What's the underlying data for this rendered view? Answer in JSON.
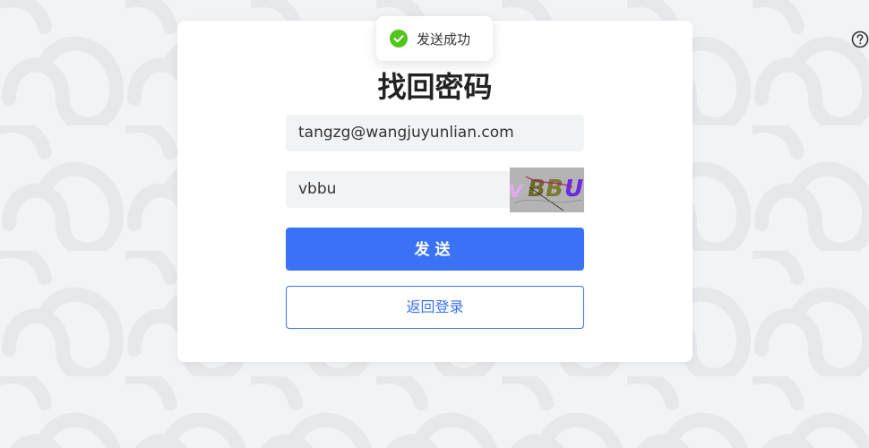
{
  "page": {
    "title": "找回密码",
    "help_icon": "question-circle-icon"
  },
  "form": {
    "email_value": "tangzg@wangjuyunlian.com",
    "captcha_value": "vbbu",
    "captcha_image_text": "vBBU",
    "send_label": "发送",
    "back_label": "返回登录"
  },
  "toast": {
    "message": "发送成功",
    "icon": "check-circle-icon"
  },
  "colors": {
    "primary": "#3a72f5",
    "success": "#52c41a",
    "background": "#f2f3f5",
    "card": "#ffffff"
  }
}
